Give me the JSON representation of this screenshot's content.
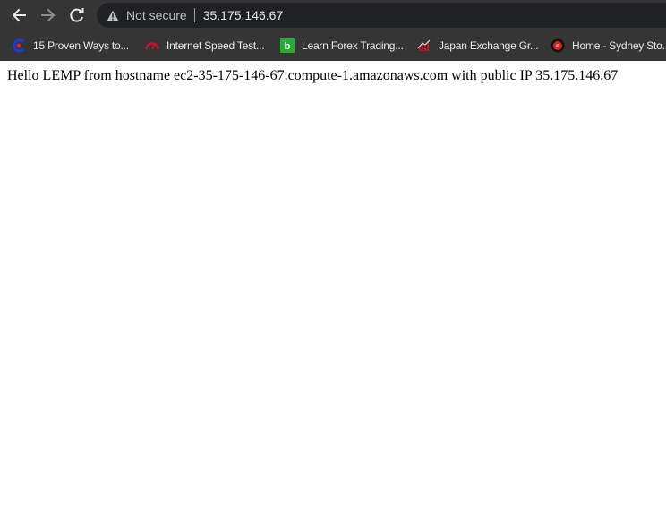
{
  "toolbar": {
    "back_icon": "back-arrow-icon",
    "forward_icon": "forward-arrow-icon",
    "reload_icon": "reload-icon",
    "security_icon": "warning-triangle-icon",
    "security_label": "Not secure",
    "url": "35.175.146.67"
  },
  "bookmarks": [
    {
      "label": "15 Proven Ways to...",
      "icon": "blue-red-c-icon"
    },
    {
      "label": "Internet Speed Test...",
      "icon": "speedometer-icon"
    },
    {
      "label": "Learn Forex Trading...",
      "icon": "green-b-icon"
    },
    {
      "label": "Japan Exchange Gr...",
      "icon": "jpx-icon"
    },
    {
      "label": "Home - Sydney Sto...",
      "icon": "red-circle-icon"
    }
  ],
  "page": {
    "text": "Hello LEMP from hostname ec2-35-175-146-67.compute-1.amazonaws.com with public IP 35.175.146.67"
  },
  "colors": {
    "chrome_bg": "#353535",
    "omnibox_bg": "#202124",
    "page_bg": "#ffffff"
  }
}
